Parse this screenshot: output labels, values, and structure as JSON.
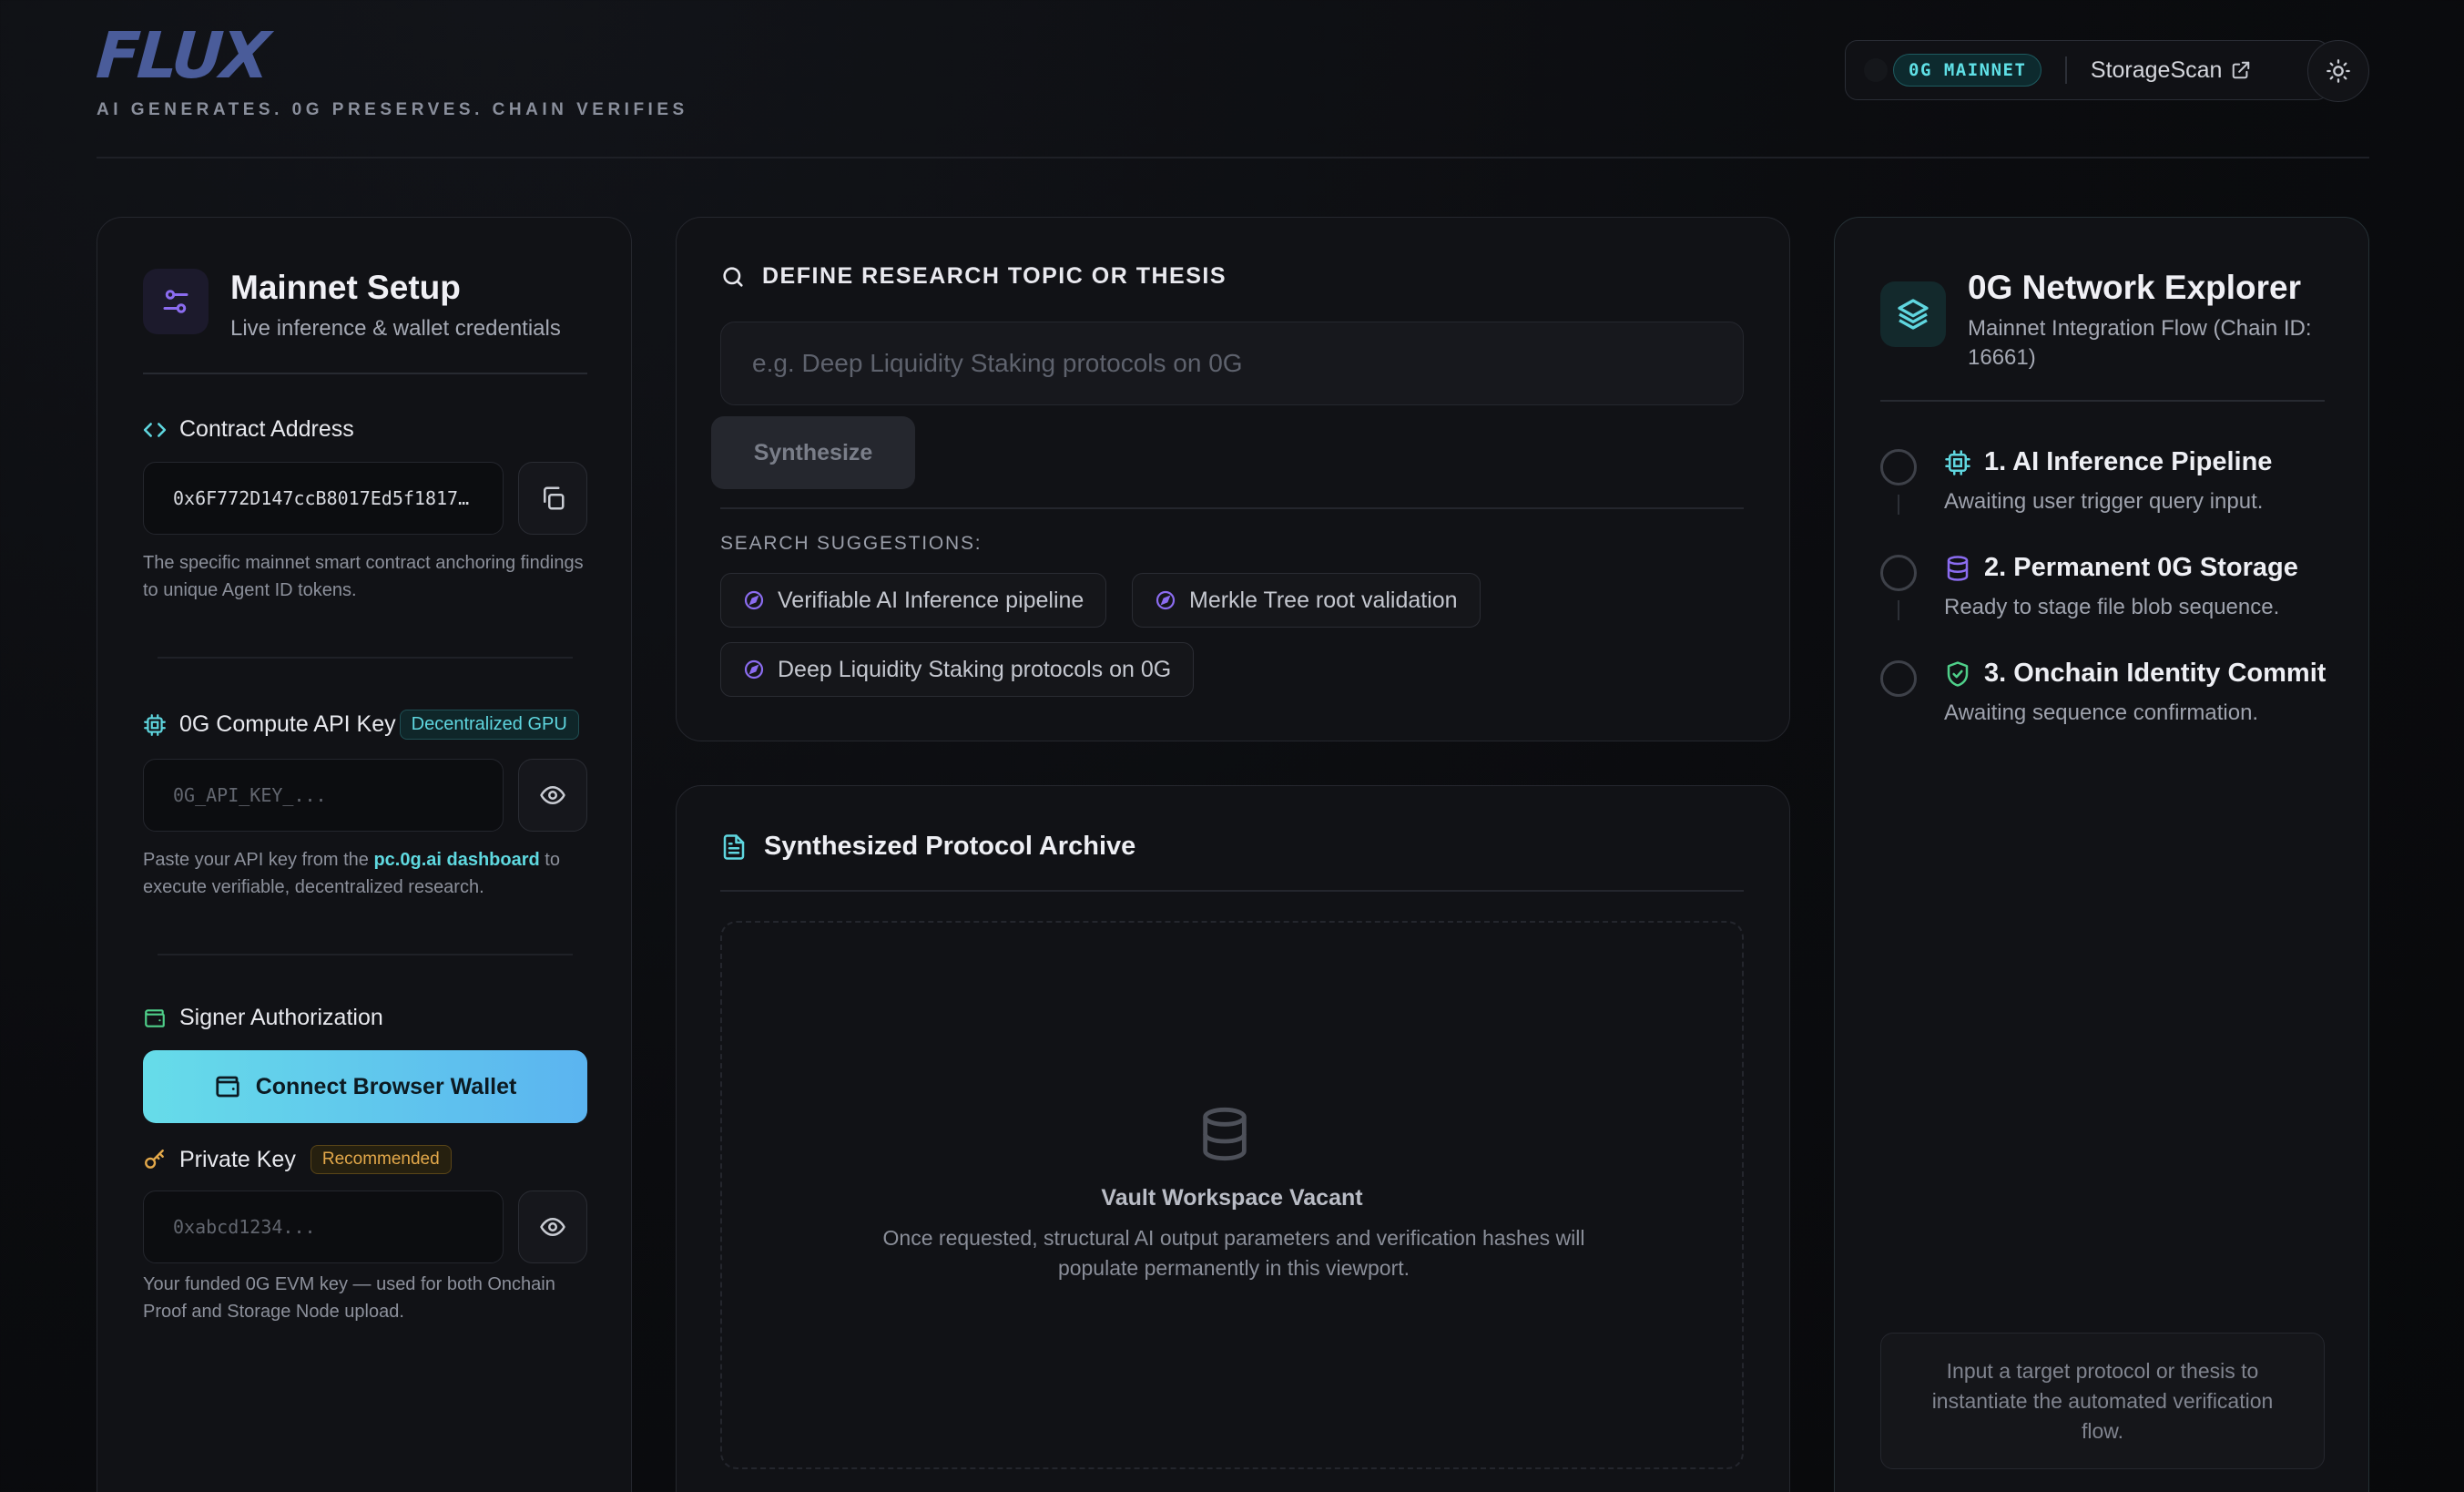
{
  "header": {
    "logo": "FLUX",
    "tagline": "AI GENERATES. 0G PRESERVES. CHAIN VERIFIES",
    "network_badge": "0G MAINNET",
    "storagescan_label": "StorageScan"
  },
  "setup": {
    "title": "Mainnet Setup",
    "subtitle": "Live inference & wallet credentials",
    "contract": {
      "label": "Contract Address",
      "value": "0x6F772D147ccB8017Ed5f1817…",
      "help": "The specific mainnet smart contract anchoring findings to unique Agent ID tokens."
    },
    "api_key": {
      "label": "0G Compute API Key",
      "tag": "Decentralized GPU",
      "placeholder": "0G_API_KEY_...",
      "help_prefix": "Paste your API key from the ",
      "help_link": "pc.0g.ai dashboard",
      "help_suffix": " to execute verifiable, decentralized research."
    },
    "signer": {
      "label": "Signer Authorization",
      "connect_label": "Connect Browser Wallet"
    },
    "private_key": {
      "label": "Private Key",
      "tag": "Recommended",
      "placeholder": "0xabcd1234...",
      "help": "Your funded 0G EVM key — used for both Onchain Proof and Storage Node upload."
    }
  },
  "research": {
    "title": "DEFINE RESEARCH TOPIC OR THESIS",
    "placeholder": "e.g. Deep Liquidity Staking protocols on 0G",
    "synthesize_label": "Synthesize",
    "suggestions_label": "SEARCH SUGGESTIONS:",
    "suggestions": [
      "Verifiable AI Inference pipeline",
      "Merkle Tree root validation",
      "Deep Liquidity Staking protocols on 0G"
    ]
  },
  "archive": {
    "title": "Synthesized Protocol Archive",
    "empty_title": "Vault Workspace Vacant",
    "empty_desc": "Once requested, structural AI output parameters and verification hashes will populate permanently in this viewport."
  },
  "explorer": {
    "title": "0G Network Explorer",
    "subtitle": "Mainnet Integration Flow (Chain ID: 16661)",
    "steps": [
      {
        "title": "1. AI Inference Pipeline",
        "desc": "Awaiting user trigger query input.",
        "icon": "chip-icon",
        "color": "#5fd6df"
      },
      {
        "title": "2. Permanent 0G Storage",
        "desc": "Ready to stage file blob sequence.",
        "icon": "database-icon",
        "color": "#8b6cf0"
      },
      {
        "title": "3. Onchain Identity Commit",
        "desc": "Awaiting sequence confirmation.",
        "icon": "shield-check-icon",
        "color": "#4fd08a"
      }
    ],
    "note": "Input a target protocol or thesis to instantiate the automated verification flow."
  },
  "colors": {
    "accent_cyan": "#5fd9e0",
    "accent_purple": "#8b6cf0",
    "accent_green": "#4fd08a",
    "accent_amber": "#e3a84a"
  }
}
